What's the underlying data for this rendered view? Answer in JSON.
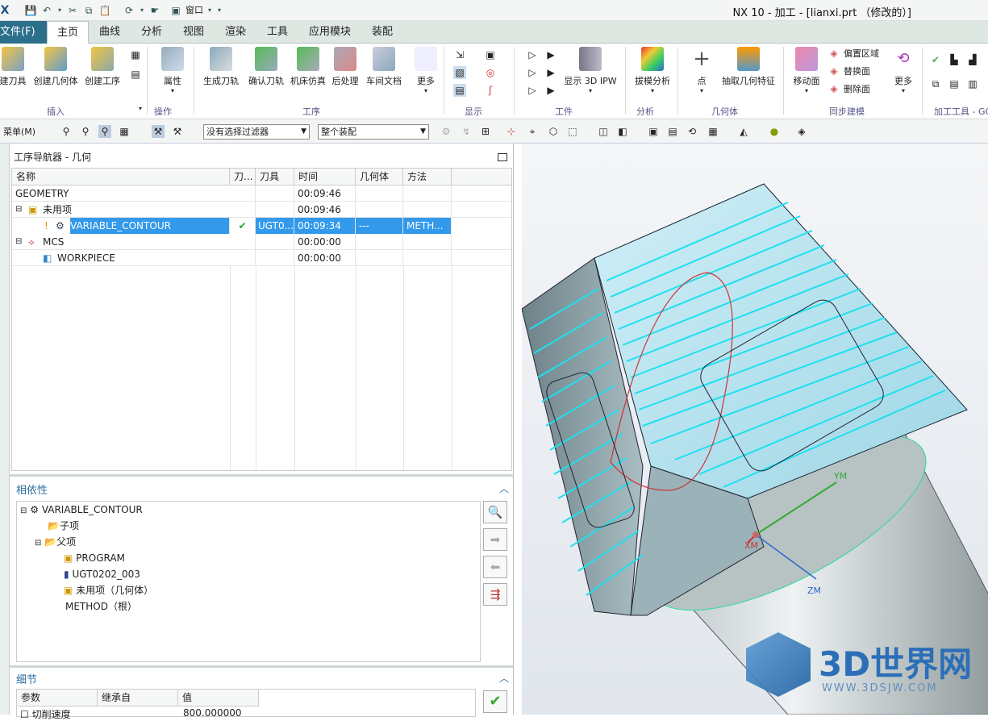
{
  "window": {
    "title": "NX 10 - 加工 - [lianxi.prt （修改的）]",
    "window_menu": "窗口"
  },
  "tabs": {
    "file": "文件(F)",
    "items": [
      "主页",
      "曲线",
      "分析",
      "视图",
      "渲染",
      "工具",
      "应用模块",
      "装配"
    ]
  },
  "ribbon": {
    "buttons": [
      "建刀具",
      "创建几何体",
      "创建工序",
      "属性",
      "生成刀轨",
      "确认刀轨",
      "机床仿真",
      "后处理",
      "车间文档",
      "更多",
      "显示 3D IPW",
      "拔模分析",
      "点",
      "抽取几何特征",
      "移动面",
      "偏置区域",
      "替换面",
      "删除面",
      "更多"
    ],
    "groups": [
      "插入",
      "操作",
      "工序",
      "显示",
      "工件",
      "分析",
      "几何体",
      "同步建模",
      "加工工具 - GC"
    ]
  },
  "toolbar": {
    "menu": "菜单(M)",
    "filter": "没有选择过滤器",
    "assembly": "整个装配"
  },
  "navigator": {
    "title": "工序导航器 - 几何",
    "columns": [
      "名称",
      "刀...",
      "刀具",
      "时间",
      "几何体",
      "方法"
    ],
    "rows": [
      {
        "name": "GEOMETRY",
        "check": "",
        "tool": "",
        "time": "00:09:46",
        "geom": "",
        "method": ""
      },
      {
        "name": "未用项",
        "check": "",
        "tool": "",
        "time": "00:09:46",
        "geom": "",
        "method": ""
      },
      {
        "name": "VARIABLE_CONTOUR",
        "check": "✔",
        "tool": "UGT0...",
        "time": "00:09:34",
        "geom": "---",
        "method": "METH..."
      },
      {
        "name": "MCS",
        "check": "",
        "tool": "",
        "time": "00:00:00",
        "geom": "",
        "method": ""
      },
      {
        "name": "WORKPIECE",
        "check": "",
        "tool": "",
        "time": "00:00:00",
        "geom": "",
        "method": ""
      }
    ]
  },
  "dependency": {
    "title": "相依性",
    "items": [
      "VARIABLE_CONTOUR",
      "子项",
      "父项",
      "PROGRAM",
      "UGT0202_003",
      "未用项（几何体）",
      "METHOD（根）"
    ]
  },
  "details": {
    "title": "细节",
    "columns": [
      "参数",
      "继承自",
      "值"
    ],
    "row": [
      "切削速度",
      "",
      "800.000000"
    ]
  },
  "viewport": {
    "axis_x": "XM",
    "axis_y": "YM",
    "axis_z": "ZM"
  },
  "watermark": {
    "brand": "3D世界网",
    "url": "WWW.3DSJW.COM"
  }
}
